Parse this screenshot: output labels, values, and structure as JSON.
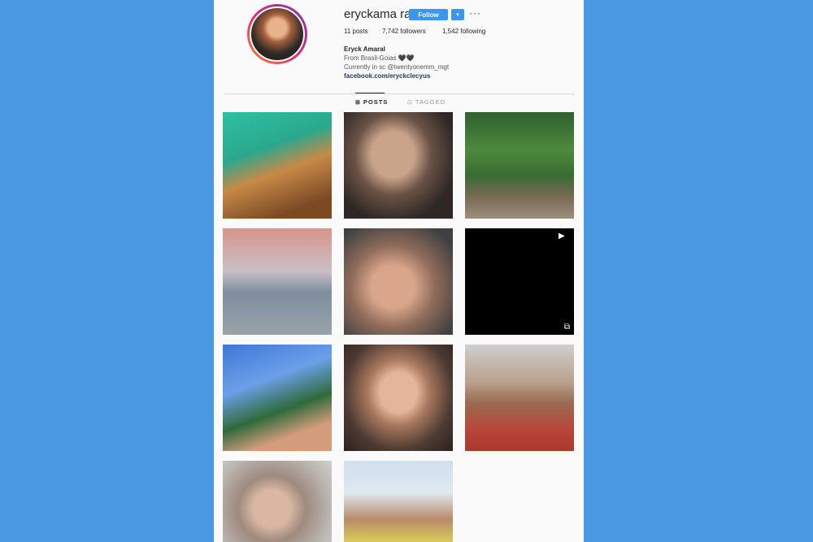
{
  "profile": {
    "username": "eryckama ral",
    "follow_label": "Follow",
    "dropdown_glyph": "▾",
    "more_glyph": "···",
    "posts": "11 posts",
    "followers": "7,742 followers",
    "following": "1,542 following",
    "name": "Eryck Amaral",
    "bio_line1": "From Brasil-Goias 🖤🖤",
    "bio_line2": "Currently in sc @twentyonemm_mgt",
    "link": "facebook.com/eryckclecyus"
  },
  "tabs": [
    {
      "label": "POSTS",
      "icon": "grid-icon",
      "glyph": "⊞",
      "active": true
    },
    {
      "label": "TAGGED",
      "icon": "tag-icon",
      "glyph": "⊡",
      "active": false
    }
  ],
  "colors": {
    "background": "#4a98e2",
    "page": "#fafafa",
    "accent": "#3897f0"
  },
  "posts": [
    {
      "kind": "photo"
    },
    {
      "kind": "photo"
    },
    {
      "kind": "photo"
    },
    {
      "kind": "photo"
    },
    {
      "kind": "photo"
    },
    {
      "kind": "video",
      "icon": "video-icon",
      "glyph": "▶",
      "overlay_icon": "multi-post-icon"
    },
    {
      "kind": "photo"
    },
    {
      "kind": "photo"
    },
    {
      "kind": "photo"
    },
    {
      "kind": "photo"
    },
    {
      "kind": "photo"
    }
  ]
}
